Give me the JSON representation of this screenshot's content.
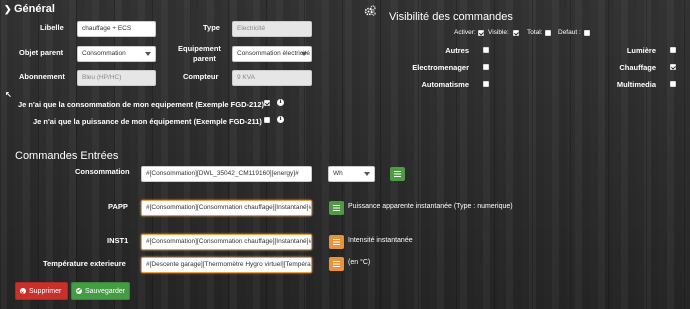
{
  "header": {
    "title": "Général",
    "collapse_glyph": "❯",
    "cogs_icon": "cogs-icon"
  },
  "general": {
    "libelle_label": "Libelle",
    "libelle_value": "chauffage + ECS",
    "type_label": "Type",
    "type_value": "Electricité",
    "objet_label": "Objet parent",
    "objet_value": "Consommation",
    "equipement_label_1": "Equipement",
    "equipement_label_2": "parent",
    "equipement_value": "Consommation électricité global",
    "abonnement_label": "Abonnement",
    "abonnement_value": "Bleu (HP/HC)",
    "compteur_label": "Compteur",
    "compteur_value": "9 KVA",
    "conso_only_label": "Je n'ai que la consommation de mon equipement (Exemple FGD-212)",
    "puiss_only_label": "Je n'ai que la puissance de mon équipement (Exemple FGD-211)",
    "conso_only_checked": true,
    "puiss_only_checked": false
  },
  "visibility": {
    "title": "Visibilité des commandes",
    "activer_label": "Activer:",
    "visible_label": "Visible:",
    "total_label": "Total:",
    "defaut_label": "Defaut :",
    "activer": true,
    "visible": true,
    "total": false,
    "defaut": false,
    "categories": [
      {
        "label": "Autres",
        "checked": false
      },
      {
        "label": "Lumière",
        "checked": false
      },
      {
        "label": "Electromenager",
        "checked": false
      },
      {
        "label": "Chauffage",
        "checked": true
      },
      {
        "label": "Automatisme",
        "checked": false
      },
      {
        "label": "Multimedia",
        "checked": false
      }
    ]
  },
  "commands": {
    "title": "Commandes Entrées",
    "consommation_label": "Consommation",
    "consommation_value": "#[Consommation][DWL_35042_CM119160][energy]#",
    "consommation_unit": "Wh",
    "papp_label": "PAPP",
    "papp_value": "#[Consommation][Consommation chauffage][Instantané]#",
    "papp_desc": "Puissance apparente instantanée (Type : numerique)",
    "inst1_label": "INST1",
    "inst1_value": "#[Consommation][Consommation chauffage][Instantané]#",
    "inst1_desc": "Intensité instantanée",
    "temp_label": "Température exterieure",
    "temp_value": "#[Descente garage][Thermomètre Hygro virtuel][Température]#",
    "temp_desc": "(en °C)"
  },
  "actions": {
    "delete_label": "Supprimer",
    "save_label": "Sauvegarder"
  }
}
